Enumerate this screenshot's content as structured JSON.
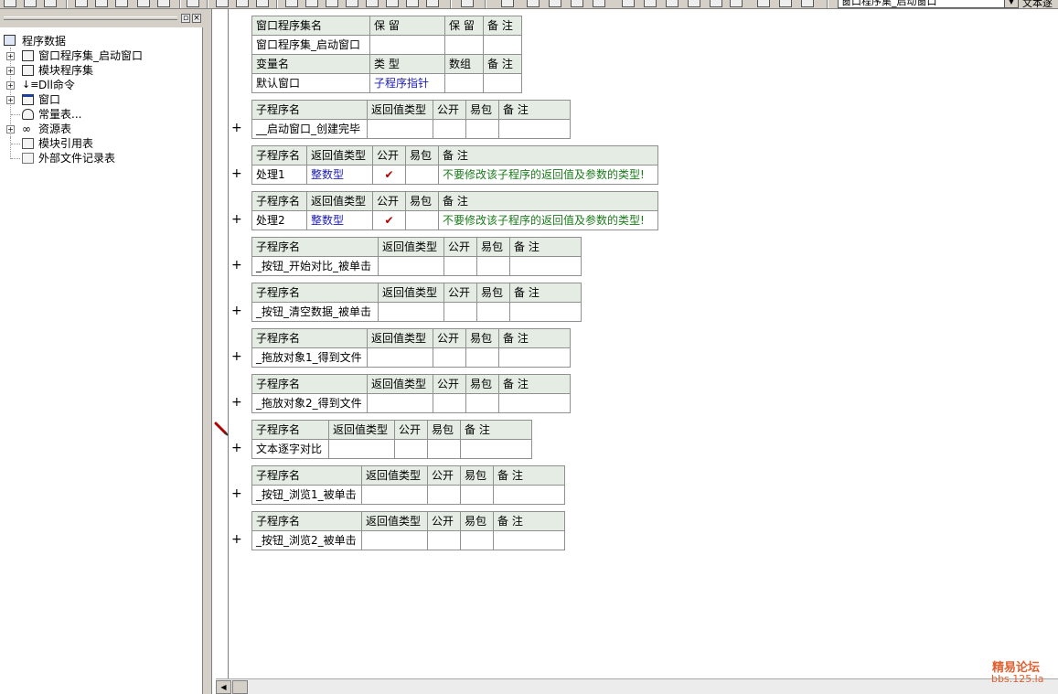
{
  "toolbar": {
    "module_combo_value": "窗口程序集_启动窗口",
    "text_label": "文本逐"
  },
  "tree": {
    "root": "程序数据",
    "items": [
      {
        "label": "窗口程序集_启动窗口",
        "expandable": true,
        "icon": "module-stack-icon"
      },
      {
        "label": "模块程序集",
        "expandable": true,
        "icon": "module-stack-icon"
      },
      {
        "label": "Dll命令",
        "expandable": true,
        "icon": "dll-command-icon"
      },
      {
        "label": "窗口",
        "expandable": true,
        "icon": "window-icon"
      },
      {
        "label": "常量表...",
        "expandable": false,
        "icon": "constants-icon"
      },
      {
        "label": "资源表",
        "expandable": true,
        "icon": "resources-icon"
      },
      {
        "label": "模块引用表",
        "expandable": false,
        "icon": "module-ref-icon"
      },
      {
        "label": "外部文件记录表",
        "expandable": false,
        "icon": "external-file-icon"
      }
    ]
  },
  "assembly_table": {
    "headers": [
      "窗口程序集名",
      "保 留",
      "保 留",
      "备 注"
    ],
    "row": [
      "窗口程序集_启动窗口",
      "",
      "",
      ""
    ],
    "var_headers": [
      "变量名",
      "类 型",
      "数组",
      "备 注"
    ],
    "var_row": [
      "默认窗口",
      "子程序指针",
      "",
      ""
    ]
  },
  "sub_headers": {
    "name": "子程序名",
    "return_type": "返回值类型",
    "public": "公开",
    "easy_pack": "易包",
    "note": "备 注"
  },
  "subs": [
    {
      "name": "__启动窗口_创建完毕",
      "return_type": "",
      "public": "",
      "easy_pack": "",
      "note": ""
    },
    {
      "name": "处理1",
      "return_type": "整数型",
      "public": "✔",
      "easy_pack": "",
      "note": "不要修改该子程序的返回值及参数的类型!"
    },
    {
      "name": "处理2",
      "return_type": "整数型",
      "public": "✔",
      "easy_pack": "",
      "note": "不要修改该子程序的返回值及参数的类型!"
    },
    {
      "name": "_按钮_开始对比_被单击",
      "return_type": "",
      "public": "",
      "easy_pack": "",
      "note": ""
    },
    {
      "name": "_按钮_清空数据_被单击",
      "return_type": "",
      "public": "",
      "easy_pack": "",
      "note": ""
    },
    {
      "name": "_拖放对象1_得到文件",
      "return_type": "",
      "public": "",
      "easy_pack": "",
      "note": ""
    },
    {
      "name": "_拖放对象2_得到文件",
      "return_type": "",
      "public": "",
      "easy_pack": "",
      "note": ""
    },
    {
      "name": "文本逐字对比",
      "return_type": "",
      "public": "",
      "easy_pack": "",
      "note": ""
    },
    {
      "name": "_按钮_浏览1_被单击",
      "return_type": "",
      "public": "",
      "easy_pack": "",
      "note": ""
    },
    {
      "name": "_按钮_浏览2_被单击",
      "return_type": "",
      "public": "",
      "easy_pack": "",
      "note": ""
    }
  ],
  "expand_glyph": "+",
  "watermark": {
    "line1": "精易论坛",
    "line2": "bbs.125.la"
  }
}
